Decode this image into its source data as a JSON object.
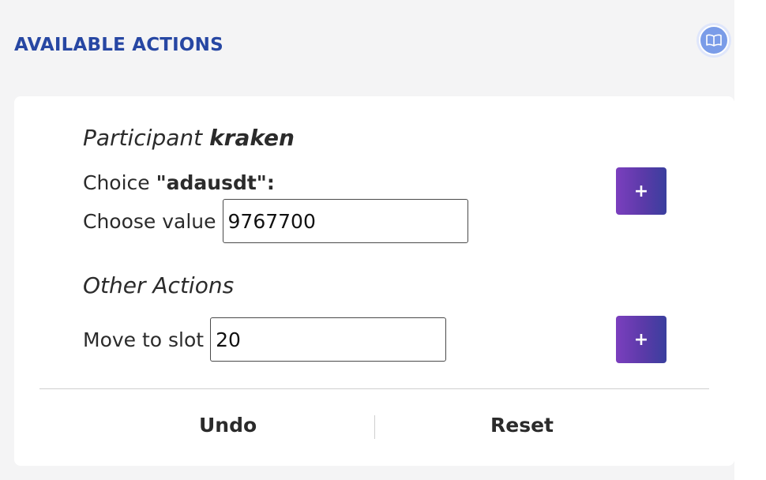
{
  "header": {
    "title": "AVAILABLE ACTIONS",
    "help_icon": "book-open-icon"
  },
  "participant": {
    "prefix": "Participant",
    "name": "kraken"
  },
  "choice": {
    "prefix": "Choice",
    "name": "\"adausdt\":",
    "value_label": "Choose value",
    "value": "9767700",
    "add_label": "+"
  },
  "other_actions": {
    "title": "Other Actions",
    "move_label": "Move to slot",
    "slot_value": "20",
    "add_label": "+"
  },
  "footer": {
    "undo_label": "Undo",
    "reset_label": "Reset"
  },
  "colors": {
    "header_title": "#2747a3",
    "button_gradient_start": "#7b3fbe",
    "button_gradient_end": "#3a3f9e",
    "help_icon_bg": "#7a9ce8"
  }
}
